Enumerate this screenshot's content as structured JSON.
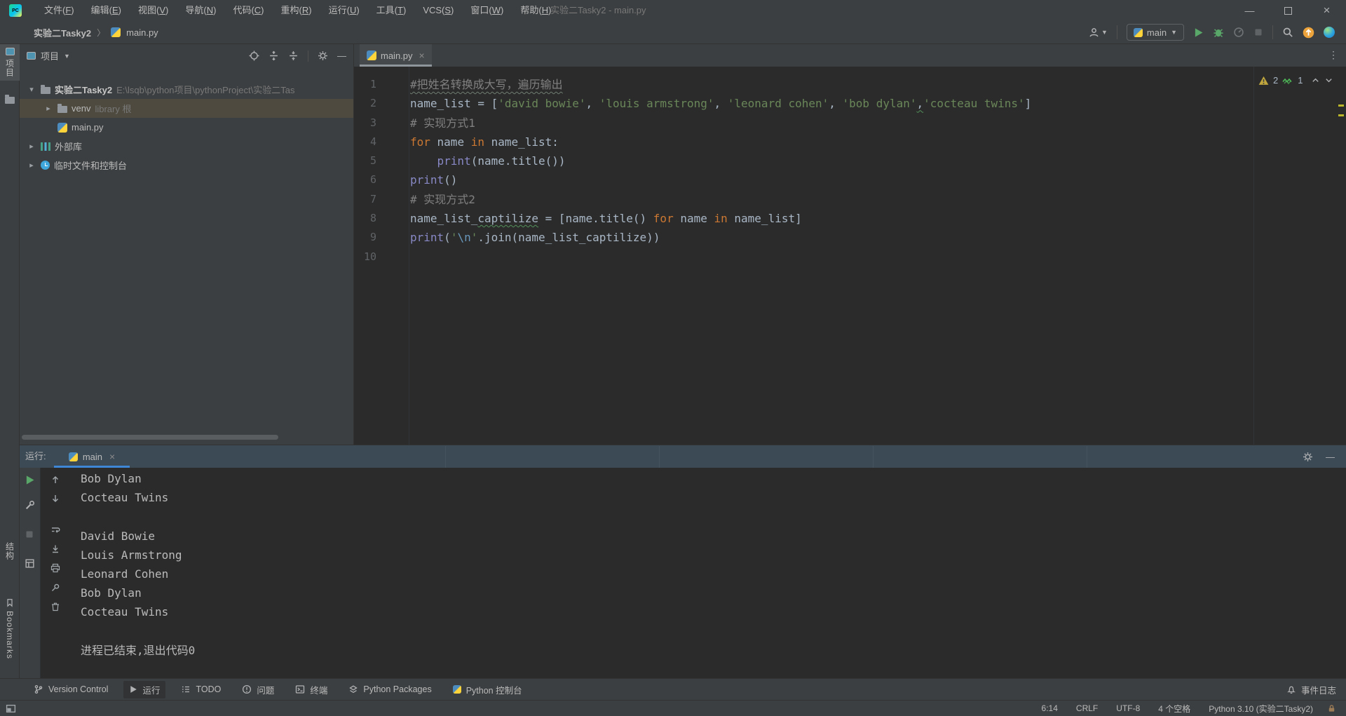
{
  "window": {
    "title": "实验二Tasky2 - main.py"
  },
  "menubar": {
    "items": [
      "文件(F)",
      "编辑(E)",
      "视图(V)",
      "导航(N)",
      "代码(C)",
      "重构(R)",
      "运行(U)",
      "工具(T)",
      "VCS(S)",
      "窗口(W)",
      "帮助(H)"
    ]
  },
  "toolbar": {
    "breadcrumb": [
      "实验二Tasky2",
      "main.py"
    ],
    "run_config": "main"
  },
  "stripes": {
    "project": "项目",
    "structure": "结构",
    "bookmarks": "Bookmarks"
  },
  "project_panel": {
    "title": "项目",
    "tree": [
      {
        "indent": 0,
        "chevron": "open",
        "icon": "folder",
        "label": "实验二Tasky2",
        "bold": true,
        "extra": "E:\\lsqb\\python项目\\pythonProject\\实验二Tas",
        "selected": false
      },
      {
        "indent": 1,
        "chevron": "closed",
        "icon": "folder",
        "label": "venv",
        "extra": "library 根",
        "selected": true
      },
      {
        "indent": 1,
        "chevron": "none",
        "icon": "python",
        "label": "main.py",
        "extra": "",
        "selected": false
      },
      {
        "indent": 0,
        "chevron": "closed",
        "icon": "libs",
        "label": "外部库",
        "extra": "",
        "selected": false
      },
      {
        "indent": 0,
        "chevron": "closed",
        "icon": "scratch",
        "label": "临时文件和控制台",
        "extra": "",
        "selected": false
      }
    ]
  },
  "editor": {
    "tab": "main.py",
    "close": "×",
    "inspections": {
      "warnings": "2",
      "typos": "1"
    },
    "lines": [
      {
        "n": "1",
        "tokens": [
          [
            "comspell",
            "#把姓名转换成大写，遍历输出"
          ]
        ]
      },
      {
        "n": "2",
        "tokens": [
          [
            "def",
            "name_list = ["
          ],
          [
            "str",
            "'david bowie'"
          ],
          [
            "def",
            ", "
          ],
          [
            "str",
            "'louis armstrong'"
          ],
          [
            "def",
            ", "
          ],
          [
            "str",
            "'leonard cohen'"
          ],
          [
            "def",
            ", "
          ],
          [
            "str",
            "'bob dylan'"
          ],
          [
            "spell",
            ","
          ],
          [
            "str",
            "'cocteau twins'"
          ],
          [
            "def",
            "]"
          ]
        ]
      },
      {
        "n": "3",
        "tokens": [
          [
            "com",
            "# 实现方式1"
          ]
        ]
      },
      {
        "n": "4",
        "tokens": [
          [
            "kw",
            "for"
          ],
          [
            "def",
            " name "
          ],
          [
            "kw",
            "in"
          ],
          [
            "def",
            " name_list:"
          ]
        ]
      },
      {
        "n": "5",
        "tokens": [
          [
            "def",
            "    "
          ],
          [
            "bi",
            "print"
          ],
          [
            "def",
            "(name.title())"
          ]
        ]
      },
      {
        "n": "6",
        "tokens": [
          [
            "bi",
            "print"
          ],
          [
            "def",
            "()"
          ]
        ]
      },
      {
        "n": "7",
        "tokens": [
          [
            "com",
            "# 实现方式2"
          ]
        ]
      },
      {
        "n": "8",
        "tokens": [
          [
            "def",
            "name_list_"
          ],
          [
            "spell",
            "captilize"
          ],
          [
            "def",
            " = [name.title() "
          ],
          [
            "kw",
            "for"
          ],
          [
            "def",
            " name "
          ],
          [
            "kw",
            "in"
          ],
          [
            "def",
            " name_list]"
          ]
        ]
      },
      {
        "n": "9",
        "tokens": [
          [
            "bi",
            "print"
          ],
          [
            "def",
            "("
          ],
          [
            "str",
            "'"
          ],
          [
            "esc",
            "\\n"
          ],
          [
            "str",
            "'"
          ],
          [
            "def",
            ".join(name_list_captilize))"
          ]
        ]
      },
      {
        "n": "10",
        "tokens": []
      }
    ]
  },
  "run_panel": {
    "label": "运行:",
    "tab": "main",
    "close": "×",
    "console": [
      "Bob Dylan",
      "Cocteau Twins",
      "",
      "David Bowie",
      "Louis Armstrong",
      "Leonard Cohen",
      "Bob Dylan",
      "Cocteau Twins",
      "",
      "进程已结束,退出代码0"
    ]
  },
  "toolwindow_bar": {
    "items": [
      {
        "icon": "branch",
        "label": "Version Control",
        "active": false
      },
      {
        "icon": "play",
        "label": "运行",
        "active": true
      },
      {
        "icon": "todo",
        "label": "TODO",
        "active": false
      },
      {
        "icon": "problem",
        "label": "问题",
        "active": false
      },
      {
        "icon": "terminal",
        "label": "终端",
        "active": false
      },
      {
        "icon": "packages",
        "label": "Python Packages",
        "active": false
      },
      {
        "icon": "pyconsole",
        "label": "Python 控制台",
        "active": false
      }
    ],
    "event_log": "事件日志"
  },
  "status_bar": {
    "items": [
      "6:14",
      "CRLF",
      "UTF-8",
      "4 个空格",
      "Python 3.10 (实验二Tasky2)"
    ]
  },
  "colors": {
    "accent": "#3E86D6",
    "selection": "#4E4A3F",
    "keyword": "#CC7832",
    "string": "#6A8759",
    "builtin": "#8888C6",
    "warning": "#C0A63C",
    "run_green": "#59A869",
    "console_header": "#3C4A56"
  }
}
